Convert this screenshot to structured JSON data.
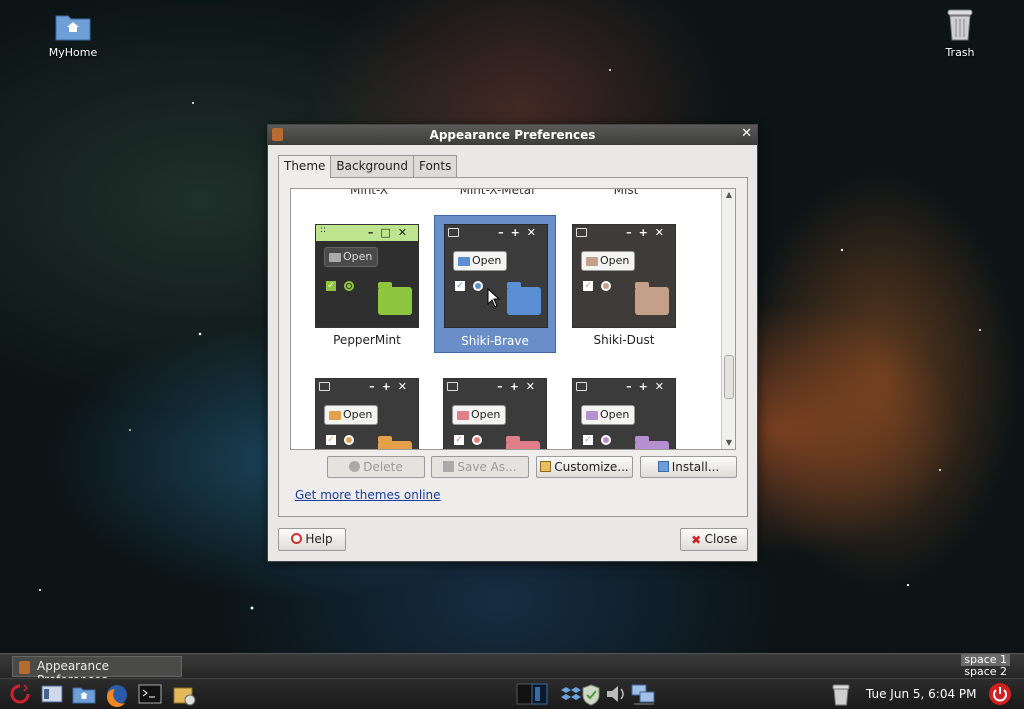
{
  "desktop": {
    "icons": [
      {
        "label": "MyHome"
      },
      {
        "label": "Trash"
      }
    ]
  },
  "window": {
    "title": "Appearance Preferences",
    "tabs": [
      {
        "label": "Theme",
        "active": true
      },
      {
        "label": "Background"
      },
      {
        "label": "Fonts"
      }
    ],
    "partial_row_labels": [
      "Mint-X",
      "Mint-X-Metal",
      "Mist"
    ],
    "themes": [
      {
        "name": "PepperMint",
        "selected": false
      },
      {
        "name": "Shiki-Brave",
        "selected": true
      },
      {
        "name": "Shiki-Dust",
        "selected": false
      }
    ],
    "lower_row_preview_label": "Open",
    "buttons": {
      "delete": "Delete",
      "save_as": "Save As...",
      "customize": "Customize...",
      "install": "Install..."
    },
    "link": "Get more themes online",
    "help": "Help",
    "close": "Close",
    "colors": {
      "selection": "#6a8fc8",
      "peppermint_green": "#8ec63f",
      "brave_blue": "#5b8fd4",
      "dust_tan": "#c4a088",
      "pink": "#e07f8a",
      "orange": "#e3a24a",
      "violet": "#b68fd0"
    }
  },
  "taskbar": {
    "task_label": "Appearance Preferences",
    "workspaces": [
      "space 1",
      "space 2"
    ],
    "clock": "Tue Jun  5,  6:04 PM"
  }
}
